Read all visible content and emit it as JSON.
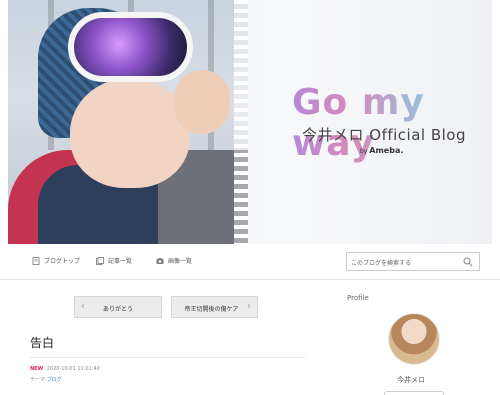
{
  "header": {
    "blog_title": "Go my way",
    "blog_subtitle": "今井メロ Official Blog",
    "by_prefix": "by",
    "by_brand": "Ameba."
  },
  "nav": {
    "items": [
      {
        "label": "ブログトップ",
        "icon": "book-icon"
      },
      {
        "label": "記事一覧",
        "icon": "list-icon"
      },
      {
        "label": "画像一覧",
        "icon": "camera-icon"
      }
    ],
    "search_placeholder": "このブログを検索する"
  },
  "pager": {
    "prev_label": "ありがとう",
    "next_label": "帝王切開後の傷ケア"
  },
  "article": {
    "title": "告白",
    "new_badge": "NEW",
    "datetime": "2020-10-01 11:01:40",
    "theme_prefix": "テーマ:",
    "theme_link": "ブログ"
  },
  "sidebar": {
    "profile_heading": "Profile",
    "profile_name": "今井メロ"
  },
  "colors": {
    "accent_new": "#e0245e",
    "link": "#2b7fc9"
  }
}
